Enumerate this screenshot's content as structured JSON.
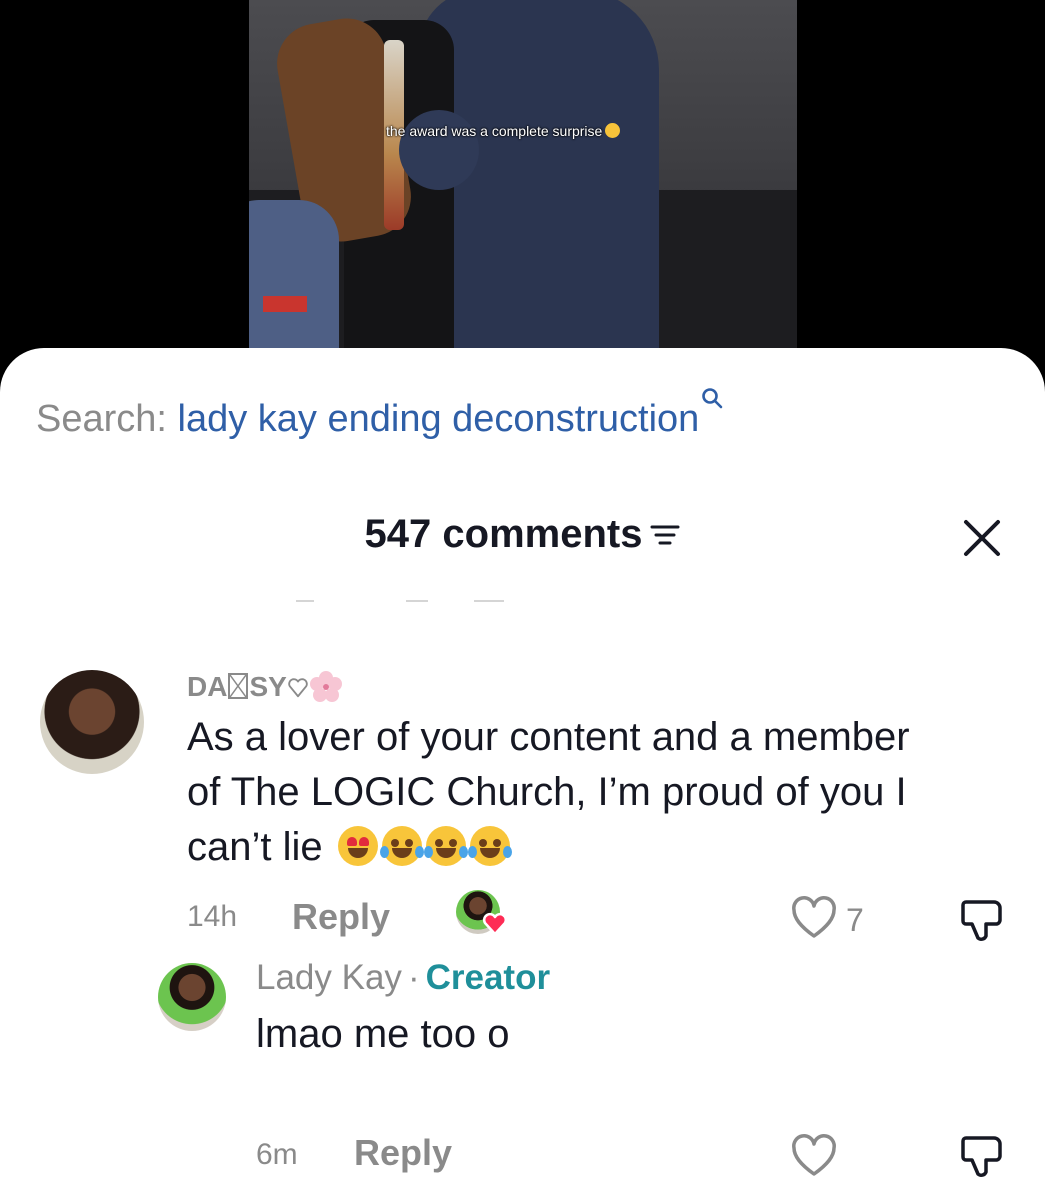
{
  "video": {
    "caption": "the award was a complete surprise"
  },
  "search": {
    "label": "Search:",
    "query": "lady kay ending deconstruction"
  },
  "comments_header": {
    "title": "547 comments"
  },
  "comments": [
    {
      "username": "DA SY",
      "username_parts": [
        "DA",
        "SY"
      ],
      "text": "As a lover of your content and a member of The LOGIC Church, I’m proud of you I can’t lie",
      "time": "14h",
      "reply_label": "Reply",
      "likes": "7",
      "liked_by_creator": true,
      "replies": [
        {
          "username": "Lady Kay",
          "badge": "Creator",
          "separator": "·",
          "text": "lmao me too o",
          "time": "6m",
          "reply_label": "Reply"
        }
      ]
    }
  ],
  "colors": {
    "search_query": "#2f5fa7",
    "creator_badge": "#1f8f9a",
    "muted_text": "#8a8a8a",
    "primary_text": "#161823"
  },
  "icons": [
    "search-icon",
    "filter-icon",
    "close-icon",
    "heart-icon",
    "dislike-icon",
    "heart-outline-icon",
    "sakura-icon"
  ]
}
